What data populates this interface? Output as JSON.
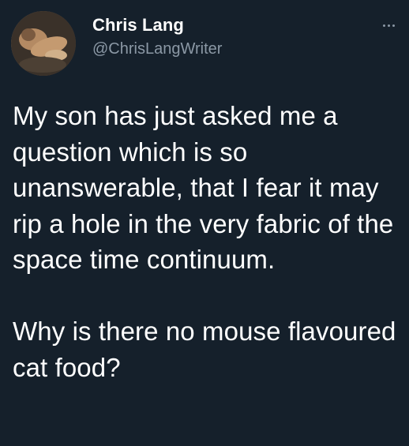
{
  "author": {
    "display_name": "Chris Lang",
    "handle": "@ChrisLangWriter"
  },
  "tweet": {
    "paragraph_1": "My son has just asked me a question which is so unanswerable, that I fear it may rip a hole in the very fabric of the space time continuum.",
    "paragraph_2": "Why is there no mouse flavoured cat food?"
  },
  "icons": {
    "avatar": "profile-photo",
    "more": "more-options-icon"
  },
  "colors": {
    "background": "#15202b",
    "text": "#ffffff",
    "secondary_text": "#8b98a5"
  }
}
